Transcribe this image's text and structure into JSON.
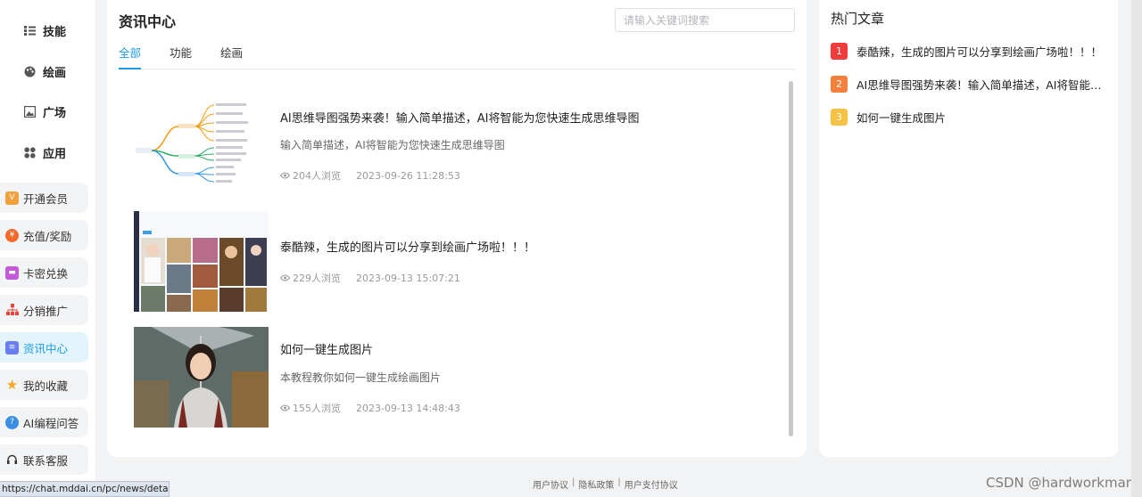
{
  "sidebar": {
    "nav": [
      {
        "label": "技能",
        "icon": "list-icon"
      },
      {
        "label": "绘画",
        "icon": "palette-icon"
      },
      {
        "label": "广场",
        "icon": "image-icon"
      },
      {
        "label": "应用",
        "icon": "apps-icon"
      }
    ],
    "menu": [
      {
        "label": "开通会员",
        "icon": "vip-icon",
        "color": "#f0a03c"
      },
      {
        "label": "充值/奖励",
        "icon": "coin-icon",
        "color": "#f56a2a"
      },
      {
        "label": "卡密兑换",
        "icon": "card-icon",
        "color": "#c35ad9"
      },
      {
        "label": "分销推广",
        "icon": "share-tree-icon",
        "color": "#e8453c"
      },
      {
        "label": "资讯中心",
        "icon": "news-icon",
        "color": "#6a7df0",
        "active": true
      },
      {
        "label": "我的收藏",
        "icon": "star-icon",
        "color": "#f5a623"
      },
      {
        "label": "AI编程问答",
        "icon": "question-icon",
        "color": "#3a8ee6"
      },
      {
        "label": "联系客服",
        "icon": "headset-icon",
        "color": "#333333"
      }
    ]
  },
  "main": {
    "title": "资讯中心",
    "search_placeholder": "请输入关键词搜索",
    "tabs": [
      "全部",
      "功能",
      "绘画"
    ],
    "articles": [
      {
        "title": "AI思维导图强势来袭！输入简单描述，AI将智能为您快速生成思维导图",
        "desc": "输入简单描述，AI将智能为您快速生成思维导图",
        "views": "204人浏览",
        "date": "2023-09-26 11:28:53",
        "thumb": "mindmap-thumbnail"
      },
      {
        "title": "泰酷辣，生成的图片可以分享到绘画广场啦！！！",
        "desc": "",
        "views": "229人浏览",
        "date": "2023-09-13 15:07:21",
        "thumb": "gallery-thumbnail"
      },
      {
        "title": "如何一键生成图片",
        "desc": "本教程教你如何一键生成绘画图片",
        "views": "155人浏览",
        "date": "2023-09-13 14:48:43",
        "thumb": "portrait-thumbnail"
      }
    ]
  },
  "hot": {
    "title": "热门文章",
    "items": [
      {
        "rank": "1",
        "title": "泰酷辣，生成的图片可以分享到绘画广场啦！！！",
        "color": "#f23c3c"
      },
      {
        "rank": "2",
        "title": "AI思维导图强势来袭！输入简单描述，AI将智能为您快速生成思维导图",
        "color": "#f5803e"
      },
      {
        "rank": "3",
        "title": "如何一键生成图片",
        "color": "#f7c244"
      }
    ]
  },
  "footer": {
    "links": [
      "用户协议",
      "隐私政策",
      "用户支付协议"
    ],
    "separator": "|"
  },
  "status_url": "https://chat.mddai.cn/pc/news/detail/2",
  "watermark": "CSDN @hardworkman"
}
